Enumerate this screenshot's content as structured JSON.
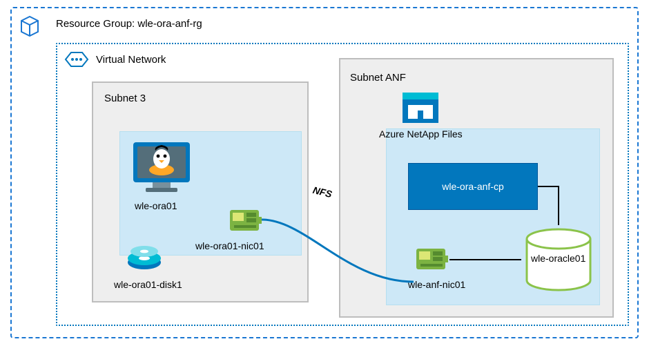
{
  "resource_group": {
    "label": "Resource Group: wle-ora-anf-rg"
  },
  "vnet": {
    "label": "Virtual Network"
  },
  "subnet3": {
    "label": "Subnet 3",
    "vm": {
      "label": "wle-ora01"
    },
    "nic": {
      "label": "wle-ora01-nic01"
    },
    "disk": {
      "label": "wle-ora01-disk1"
    }
  },
  "subnet_anf": {
    "label": "Subnet ANF",
    "service": {
      "label": "Azure NetApp Files"
    },
    "capacity_pool": {
      "label": "wle-ora-anf-cp"
    },
    "nic": {
      "label": "wle-anf-nic01"
    },
    "volume": {
      "label": "wle-oracle01"
    }
  },
  "connection": {
    "label": "NFS"
  },
  "colors": {
    "azure_blue": "#1976d2",
    "azure_deep": "#0277bd",
    "panel": "#cde8f7",
    "nic_green": "#7cb342",
    "db_green": "#8bc34a",
    "disk_teal": "#00bcd4",
    "grey_border": "#bdbdbd"
  }
}
